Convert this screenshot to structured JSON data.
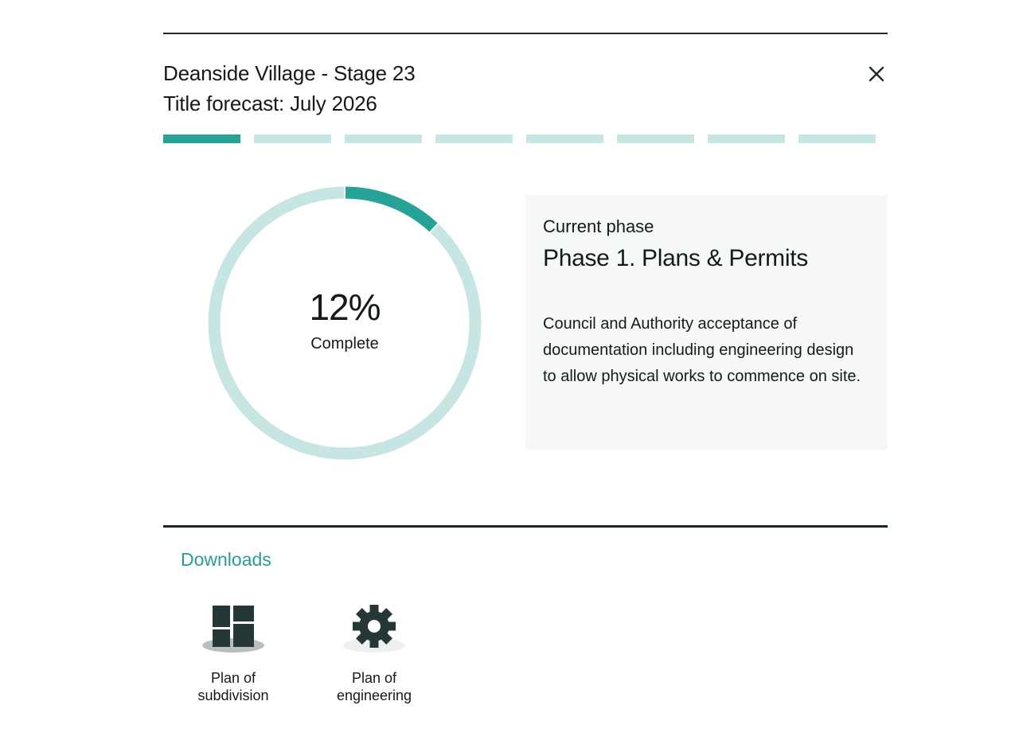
{
  "header": {
    "title_line1": "Deanside Village - Stage 23",
    "title_line2": "Title forecast: July 2026",
    "close_label": "×"
  },
  "phases": {
    "total": 8,
    "active_index": 0
  },
  "progress": {
    "percent_text": "12%",
    "percent_value": 12,
    "status_label": "Complete"
  },
  "current_phase": {
    "kicker": "Current phase",
    "name": "Phase 1. Plans & Permits",
    "description": "Council and Authority acceptance of documentation including engineering design to allow physical works to commence on site."
  },
  "downloads": {
    "title": "Downloads",
    "items": [
      {
        "label_line1": "Plan of",
        "label_line2": "subdivision",
        "icon": "floorplan-icon"
      },
      {
        "label_line1": "Plan of",
        "label_line2": "engineering",
        "icon": "gear-icon"
      }
    ]
  },
  "colors": {
    "accent": "#26a296",
    "track": "#c7e5e2",
    "dark": "#1c2a2a",
    "card_bg": "#f7f8fa"
  }
}
